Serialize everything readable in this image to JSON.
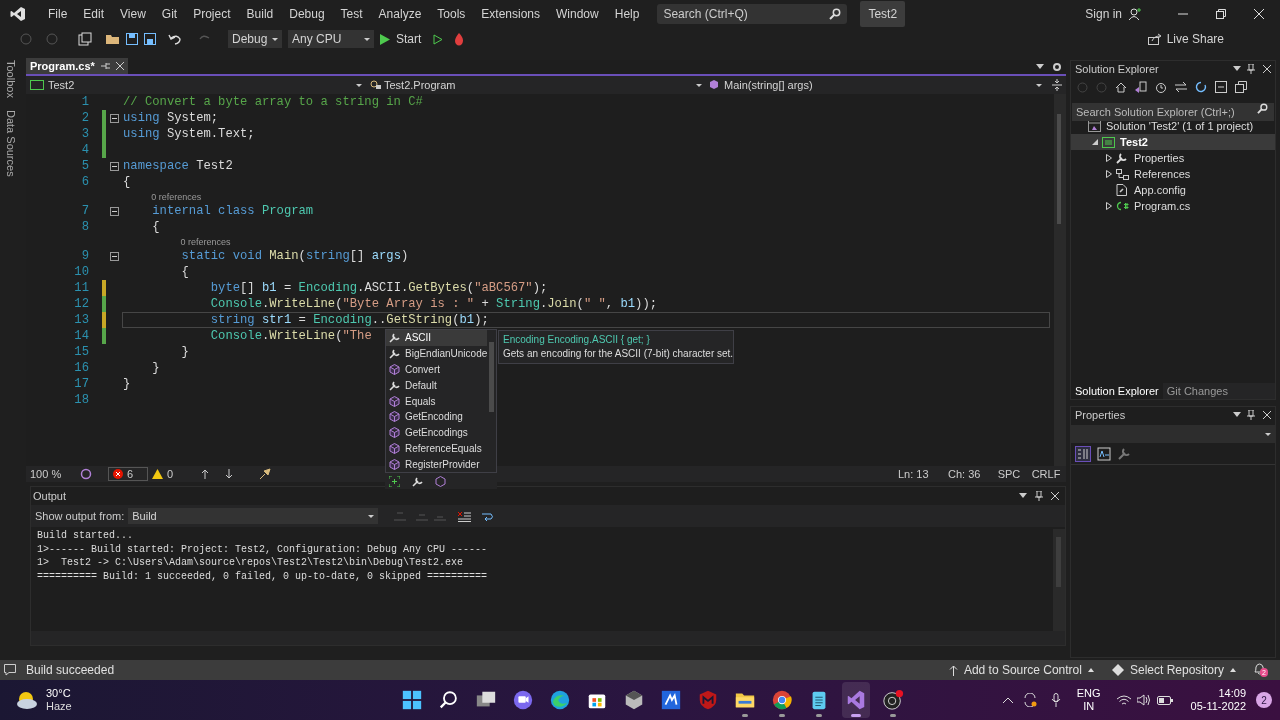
{
  "menu": [
    "File",
    "Edit",
    "View",
    "Git",
    "Project",
    "Build",
    "Debug",
    "Test",
    "Analyze",
    "Tools",
    "Extensions",
    "Window",
    "Help"
  ],
  "search": {
    "placeholder": "Search (Ctrl+Q)"
  },
  "solution_badge": "Test2",
  "sign_in": "Sign in",
  "toolbar": {
    "configuration": "Debug",
    "platform": "Any CPU",
    "start": "Start",
    "live_share": "Live Share"
  },
  "side_tabs": [
    "Toolbox",
    "Data Sources"
  ],
  "document_tabs": [
    {
      "title": "Program.cs*",
      "selected": true
    }
  ],
  "nav_bar": {
    "project": "Test2",
    "type": "Test2.Program",
    "member": "Main(string[] args)"
  },
  "code_lines": [
    {
      "number": "1",
      "current": false,
      "changed": false,
      "fold": false,
      "tokens": [
        {
          "t": "// Convert a byte array to a string in C#",
          "kind": "comment"
        }
      ]
    },
    {
      "number": "2",
      "current": false,
      "changed": true,
      "saved": true,
      "fold": true,
      "tokens": [
        {
          "t": "using",
          "kind": "keyword"
        },
        {
          "t": " System;",
          "kind": "plain"
        }
      ]
    },
    {
      "number": "3",
      "current": false,
      "changed": true,
      "saved": true,
      "fold": false,
      "tokens": [
        {
          "t": "using",
          "kind": "keyword"
        },
        {
          "t": " System.Text;",
          "kind": "plain"
        }
      ]
    },
    {
      "number": "4",
      "current": false,
      "changed": true,
      "saved": true,
      "fold": false
    },
    {
      "number": "5",
      "current": false,
      "changed": false,
      "fold": true,
      "tokens": [
        {
          "t": "namespace",
          "kind": "keyword"
        },
        {
          "t": " Test2",
          "kind": "plain"
        }
      ]
    },
    {
      "number": "6",
      "current": false,
      "changed": false,
      "fold": false,
      "tokens": [
        {
          "t": "{",
          "kind": "plain"
        }
      ]
    },
    {
      "number": "7",
      "current": false,
      "changed": false,
      "fold": true,
      "lens": "0 references",
      "tokens": [
        {
          "t": "    internal class",
          "kind": "keyword"
        },
        {
          "t": " Program",
          "kind": "type"
        }
      ]
    },
    {
      "number": "8",
      "current": false,
      "changed": false,
      "fold": false,
      "tokens": [
        {
          "t": "    {",
          "kind": "plain"
        }
      ]
    },
    {
      "number": "9",
      "current": false,
      "changed": false,
      "fold": true,
      "lens": "0 references",
      "tokens": [
        {
          "t": "        static void",
          "kind": "keyword"
        },
        {
          "t": " Main",
          "kind": "method"
        },
        {
          "t": "(",
          "kind": "plain"
        },
        {
          "t": "string",
          "kind": "keyword"
        },
        {
          "t": "[] ",
          "kind": "plain"
        },
        {
          "t": "args",
          "kind": "variable"
        },
        {
          "t": ")",
          "kind": "plain"
        }
      ]
    },
    {
      "number": "10",
      "current": false,
      "changed": false,
      "fold": false,
      "tokens": [
        {
          "t": "        {",
          "kind": "plain"
        }
      ]
    },
    {
      "number": "11",
      "current": false,
      "changed": true,
      "saved": false,
      "fold": false,
      "tokens": [
        {
          "t": "            byte",
          "kind": "keyword"
        },
        {
          "t": "[] ",
          "kind": "plain"
        },
        {
          "t": "b1",
          "kind": "variable"
        },
        {
          "t": " = ",
          "kind": "plain"
        },
        {
          "t": "Encoding",
          "kind": "type"
        },
        {
          "t": ".ASCII.",
          "kind": "plain"
        },
        {
          "t": "GetBytes",
          "kind": "method"
        },
        {
          "t": "(",
          "kind": "plain"
        },
        {
          "t": "\"aBC567\"",
          "kind": "string"
        },
        {
          "t": ");",
          "kind": "plain"
        }
      ]
    },
    {
      "number": "12",
      "current": false,
      "changed": true,
      "saved": true,
      "fold": false,
      "tokens": [
        {
          "t": "            Console",
          "kind": "type"
        },
        {
          "t": ".",
          "kind": "plain"
        },
        {
          "t": "WriteLine",
          "kind": "method"
        },
        {
          "t": "(",
          "kind": "plain"
        },
        {
          "t": "\"Byte Array is : \"",
          "kind": "string"
        },
        {
          "t": " + ",
          "kind": "plain"
        },
        {
          "t": "String",
          "kind": "type"
        },
        {
          "t": ".",
          "kind": "plain"
        },
        {
          "t": "Join",
          "kind": "method"
        },
        {
          "t": "(",
          "kind": "plain"
        },
        {
          "t": "\" \"",
          "kind": "string"
        },
        {
          "t": ", ",
          "kind": "plain"
        },
        {
          "t": "b1",
          "kind": "variable"
        },
        {
          "t": "));",
          "kind": "plain"
        }
      ]
    },
    {
      "number": "13",
      "current": true,
      "changed": true,
      "saved": false,
      "fold": false,
      "tokens": [
        {
          "t": "            string",
          "kind": "keyword"
        },
        {
          "t": " str1",
          "kind": "variable"
        },
        {
          "t": " = ",
          "kind": "plain"
        },
        {
          "t": "Encoding",
          "kind": "type"
        },
        {
          "t": "..",
          "kind": "plain"
        },
        {
          "t": "GetString",
          "kind": "method"
        },
        {
          "t": "(",
          "kind": "plain"
        },
        {
          "t": "b1",
          "kind": "variable"
        },
        {
          "t": ");",
          "kind": "plain"
        }
      ]
    },
    {
      "number": "14",
      "current": false,
      "changed": true,
      "saved": true,
      "fold": false,
      "tokens": [
        {
          "t": "            Console",
          "kind": "type"
        },
        {
          "t": ".",
          "kind": "plain"
        },
        {
          "t": "WriteLine",
          "kind": "method"
        },
        {
          "t": "(",
          "kind": "plain"
        },
        {
          "t": "\"The",
          "kind": "string"
        }
      ]
    },
    {
      "number": "15",
      "current": false,
      "changed": false,
      "fold": false,
      "tokens": [
        {
          "t": "        }",
          "kind": "plain"
        }
      ]
    },
    {
      "number": "16",
      "current": false,
      "changed": false,
      "fold": false,
      "tokens": [
        {
          "t": "    }",
          "kind": "plain"
        }
      ]
    },
    {
      "number": "17",
      "current": false,
      "changed": false,
      "fold": false,
      "tokens": [
        {
          "t": "}",
          "kind": "plain"
        }
      ]
    },
    {
      "number": "18",
      "current": false,
      "changed": false,
      "fold": false
    }
  ],
  "completion": {
    "items": [
      {
        "label": "ASCII",
        "kind": "property",
        "selected": true
      },
      {
        "label": "BigEndianUnicode",
        "kind": "property",
        "selected": false
      },
      {
        "label": "Convert",
        "kind": "method",
        "selected": false
      },
      {
        "label": "Default",
        "kind": "property",
        "selected": false
      },
      {
        "label": "Equals",
        "kind": "method",
        "selected": false
      },
      {
        "label": "GetEncoding",
        "kind": "method",
        "selected": false
      },
      {
        "label": "GetEncodings",
        "kind": "method",
        "selected": false
      },
      {
        "label": "ReferenceEquals",
        "kind": "method",
        "selected": false
      },
      {
        "label": "RegisterProvider",
        "kind": "method",
        "selected": false
      }
    ],
    "tooltip_signature": "Encoding Encoding.ASCII { get; }",
    "tooltip_description": "Gets an encoding for the ASCII (7-bit) character set."
  },
  "editor_status": {
    "zoom": "100 %",
    "errors": "6",
    "warnings": "0",
    "line": "Ln: 13",
    "column": "Ch: 36",
    "whitespace": "SPC",
    "line_endings": "CRLF"
  },
  "output": {
    "title": "Output",
    "source_label": "Show output from:",
    "source": "Build",
    "lines": [
      "Build started...",
      "1>------ Build started: Project: Test2, Configuration: Debug Any CPU ------",
      "1>  Test2 -> C:\\Users\\Adam\\source\\repos\\Test2\\Test2\\bin\\Debug\\Test2.exe",
      "========== Build: 1 succeeded, 0 failed, 0 up-to-date, 0 skipped =========="
    ]
  },
  "solution_explorer": {
    "title": "Solution Explorer",
    "search_placeholder": "Search Solution Explorer (Ctrl+;)",
    "tree": [
      {
        "label": "Solution 'Test2' (1 of 1 project)",
        "kind": "solution",
        "selected": false,
        "children": [
          {
            "label": "Test2",
            "kind": "project",
            "selected": true,
            "expanded": true,
            "children": [
              {
                "label": "Properties",
                "kind": "properties",
                "selected": false,
                "expanded": false
              },
              {
                "label": "References",
                "kind": "references",
                "selected": false,
                "expanded": false
              },
              {
                "label": "App.config",
                "kind": "config",
                "selected": false
              },
              {
                "label": "Program.cs",
                "kind": "csharp",
                "selected": false,
                "expanded": false
              }
            ]
          }
        ]
      }
    ]
  },
  "panel_tabs": [
    {
      "label": "Solution Explorer",
      "selected": true
    },
    {
      "label": "Git Changes",
      "selected": false
    }
  ],
  "properties": {
    "title": "Properties"
  },
  "status_bar": {
    "message": "Build succeeded",
    "source_control": "Add to Source Control",
    "repository": "Select Repository",
    "notifications": "2"
  },
  "taskbar": {
    "temperature": "30°C",
    "weather": "Haze",
    "apps": [
      {
        "kind": "start",
        "running": false,
        "selected": false
      },
      {
        "kind": "search",
        "running": false,
        "selected": false
      },
      {
        "kind": "taskview",
        "running": false,
        "selected": false
      },
      {
        "kind": "chat",
        "running": false,
        "selected": false
      },
      {
        "kind": "edge",
        "running": false,
        "selected": false
      },
      {
        "kind": "store",
        "running": false,
        "selected": false
      },
      {
        "kind": "cube",
        "running": false,
        "selected": false
      },
      {
        "kind": "editor",
        "running": false,
        "selected": false
      },
      {
        "kind": "shield",
        "running": false,
        "selected": false
      },
      {
        "kind": "folder",
        "running": true,
        "selected": false
      },
      {
        "kind": "chrome",
        "running": true,
        "selected": false
      },
      {
        "kind": "notepad",
        "running": true,
        "selected": false
      },
      {
        "kind": "vs",
        "running": true,
        "selected": true
      },
      {
        "kind": "recorder",
        "running": true,
        "selected": false
      }
    ],
    "language": "ENG",
    "region": "IN",
    "time": "14:09",
    "date": "05-11-2022",
    "notifications": "2"
  }
}
